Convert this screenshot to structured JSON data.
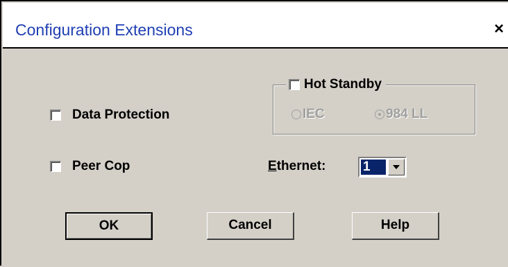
{
  "window": {
    "title": "Configuration Extensions",
    "close_glyph": "×"
  },
  "options": {
    "data_protection_label": "Data Protection",
    "data_protection_checked": false,
    "peer_cop_label": "Peer Cop",
    "peer_cop_checked": false
  },
  "hot_standby": {
    "label": "Hot Standby",
    "checked": false,
    "radio_iec_label": "IEC",
    "radio_984_label": "984 LL",
    "selected": "984 LL",
    "enabled": false
  },
  "ethernet": {
    "label_prefix": "E",
    "label_rest": "thernet:",
    "value": "1"
  },
  "buttons": {
    "ok": "OK",
    "cancel": "Cancel",
    "help": "Help"
  },
  "icons": {
    "close": "close-icon",
    "dropdown": "chevron-down-icon"
  },
  "colors": {
    "dialog_bg": "#d4d0c8",
    "title_text": "#1f3fb3",
    "selection_bg": "#0a246a",
    "disabled_text": "#a0a0a0"
  }
}
